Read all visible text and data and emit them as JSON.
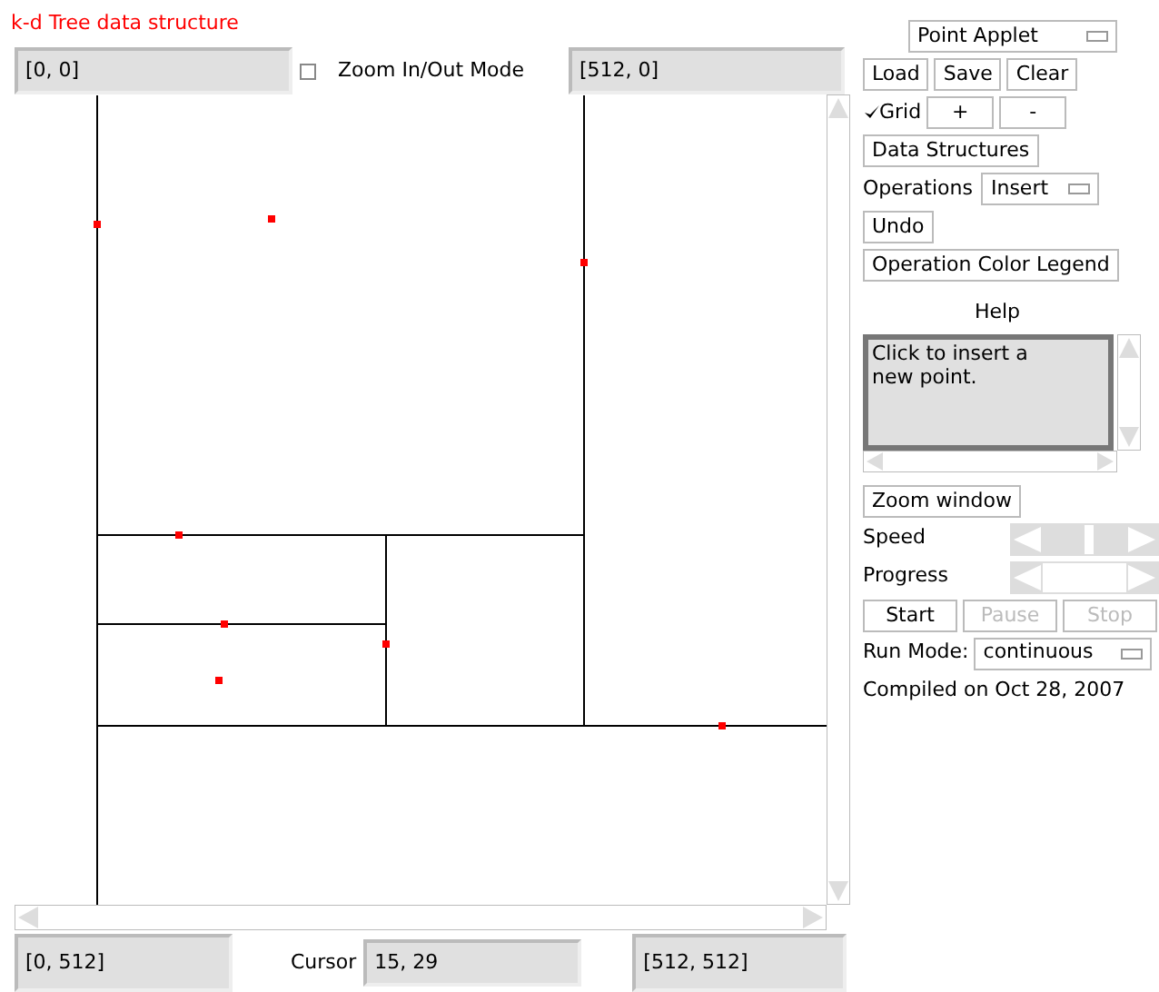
{
  "title": "k-d Tree data structure",
  "top_bar": {
    "top_left": "[0, 0]",
    "zoom_mode": {
      "label": "Zoom In/Out Mode",
      "checked": false
    },
    "top_right": "[512, 0]"
  },
  "bottom_bar": {
    "bottom_left": "[0, 512]",
    "cursor_label": "Cursor",
    "cursor_value": "15, 29",
    "bottom_right": "[512, 512]"
  },
  "panel": {
    "applet_select": "Point Applet",
    "file_buttons": [
      {
        "label": "Load",
        "disabled": false
      },
      {
        "label": "Save",
        "disabled": false
      },
      {
        "label": "Clear",
        "disabled": false
      }
    ],
    "grid": {
      "label": "Grid",
      "checked": true
    },
    "zoom_buttons": [
      "+",
      "-"
    ],
    "data_structures_button": "Data Structures",
    "operations_label": "Operations",
    "operations_select": "Insert",
    "undo_button": "Undo",
    "legend_button": "Operation Color Legend",
    "help_label": "Help",
    "help_text": "Click to insert a\nnew point.",
    "zoom_window_button": "Zoom window",
    "speed": {
      "label": "Speed",
      "level": 0.55
    },
    "progress": {
      "label": "Progress"
    },
    "run_buttons": [
      {
        "label": "Start",
        "disabled": false
      },
      {
        "label": "Pause",
        "disabled": true
      },
      {
        "label": "Stop",
        "disabled": true
      }
    ],
    "run_mode_label": "Run Mode:",
    "run_mode_select": "continuous",
    "compiled": "Compiled on Oct 28, 2007"
  }
}
